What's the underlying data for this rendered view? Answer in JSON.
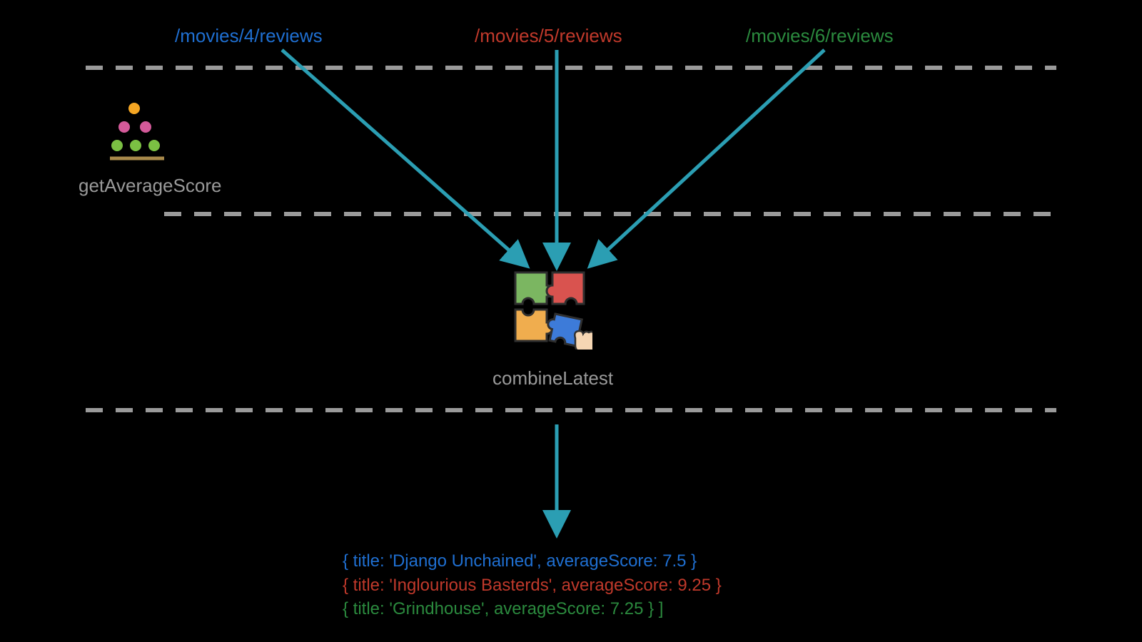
{
  "endpoints": {
    "a": "/movies/4/reviews",
    "b": "/movies/5/reviews",
    "c": "/movies/6/reviews"
  },
  "labels": {
    "avgScore": "getAverageScore",
    "combine": "combineLatest"
  },
  "output": {
    "line1": "{ title: 'Django Unchained', averageScore: 7.5 }",
    "line2": "{ title: 'Inglourious Basterds', averageScore: 9.25 }",
    "line3": "{ title: 'Grindhouse', averageScore: 7.25 } ]"
  },
  "colors": {
    "blue": "#1f6fd1",
    "red": "#c0392b",
    "green": "#2b8a3e",
    "arrow": "#2b9eb3",
    "dash": "#9a9a9a"
  }
}
